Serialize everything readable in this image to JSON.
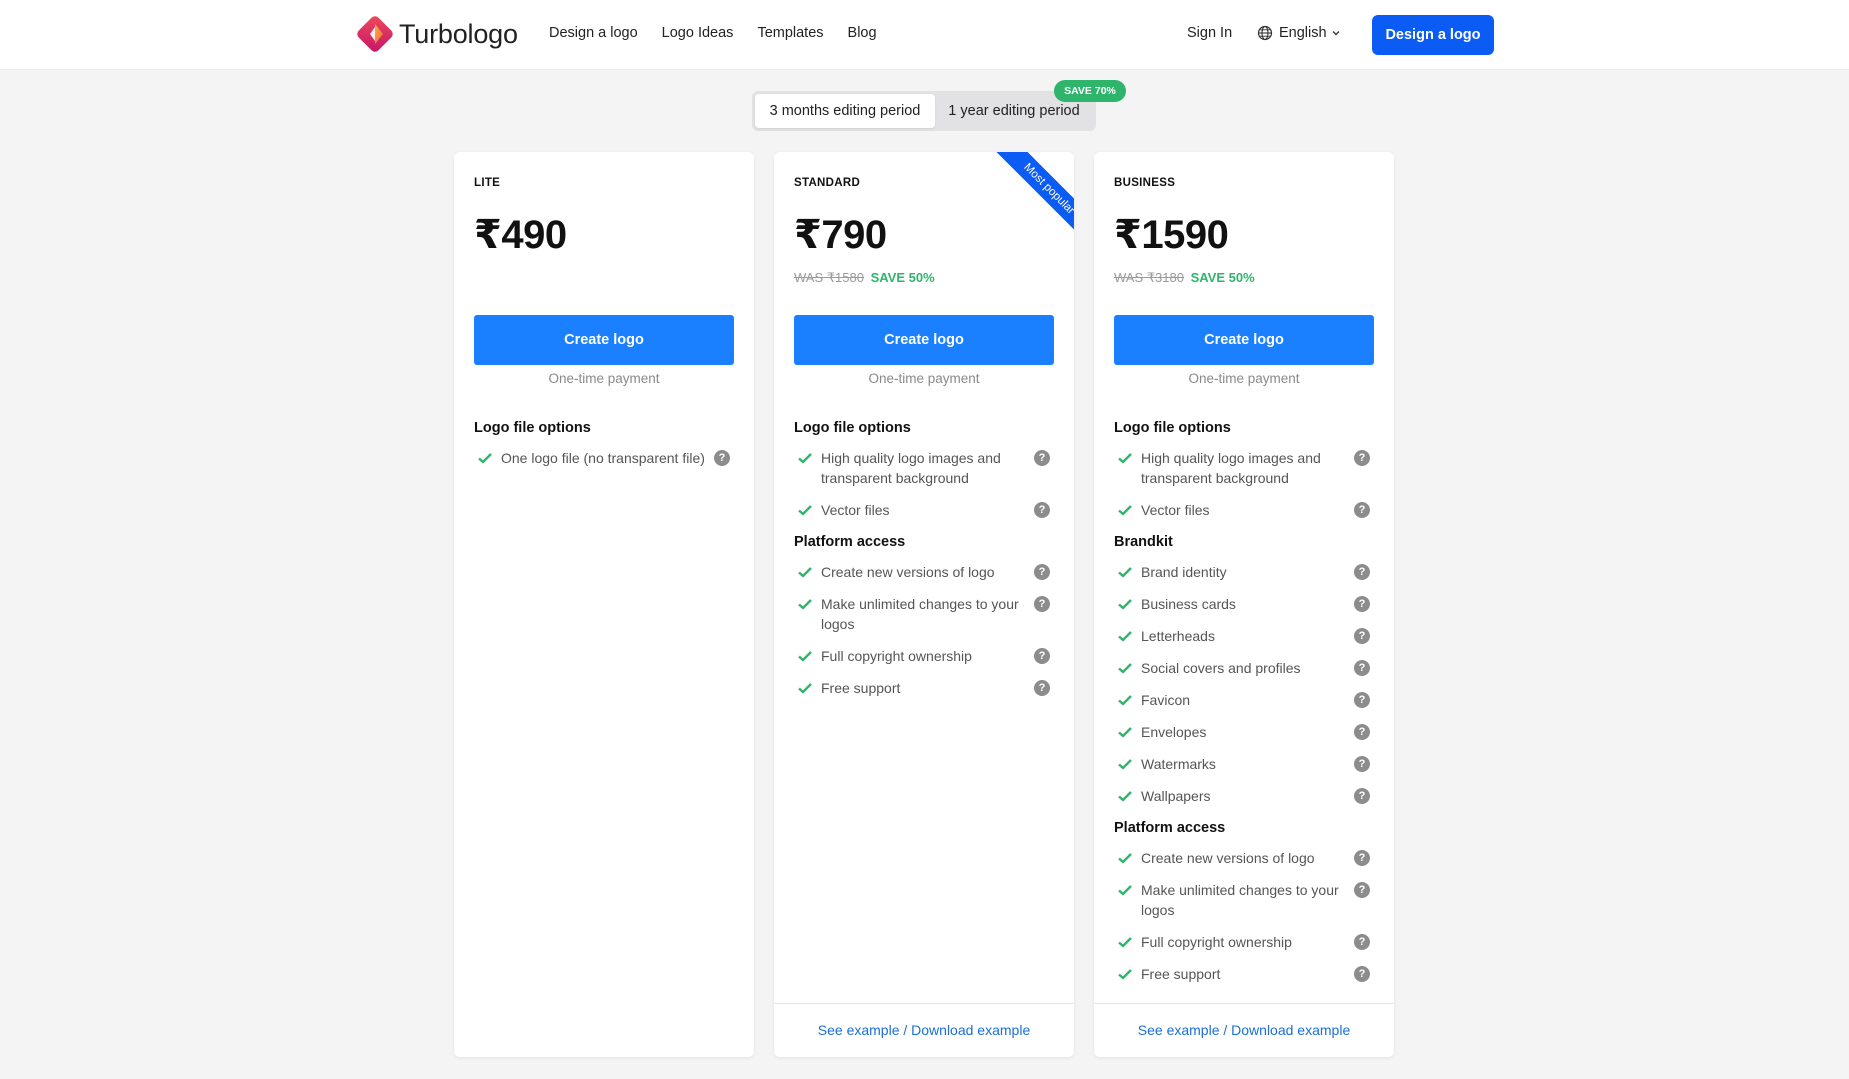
{
  "header": {
    "brand": "Turbologo",
    "nav": [
      {
        "label": "Design a logo"
      },
      {
        "label": "Logo Ideas"
      },
      {
        "label": "Templates"
      },
      {
        "label": "Blog"
      }
    ],
    "sign_in": "Sign In",
    "language": "English",
    "cta": "Design a logo"
  },
  "period_toggle": {
    "options": [
      {
        "label": "3 months editing period",
        "selected": true
      },
      {
        "label": "1 year editing period",
        "selected": false
      }
    ],
    "badge": "SAVE 70%"
  },
  "plans": [
    {
      "name": "LITE",
      "price": "₹490",
      "button": "Create logo",
      "payment_note": "One-time payment",
      "sections": [
        {
          "title": "Logo file options",
          "features": [
            "One logo file (no transparent file)"
          ]
        }
      ]
    },
    {
      "name": "STANDARD",
      "price": "₹790",
      "was": "WAS ₹1580",
      "save": "SAVE 50%",
      "ribbon": "Most popular",
      "button": "Create logo",
      "payment_note": "One-time payment",
      "sections": [
        {
          "title": "Logo file options",
          "features": [
            "High quality logo images and transparent background",
            "Vector files"
          ]
        },
        {
          "title": "Platform access",
          "features": [
            "Create new versions of logo",
            "Make unlimited changes to your logos",
            "Full copyright ownership",
            "Free support"
          ]
        }
      ],
      "footer": {
        "see": "See example",
        "separator": "/",
        "download": "Download example"
      }
    },
    {
      "name": "BUSINESS",
      "price": "₹1590",
      "was": "WAS ₹3180",
      "save": "SAVE 50%",
      "button": "Create logo",
      "payment_note": "One-time payment",
      "sections": [
        {
          "title": "Logo file options",
          "features": [
            "High quality logo images and transparent background",
            "Vector files"
          ]
        },
        {
          "title": "Brandkit",
          "features": [
            "Brand identity",
            "Business cards",
            "Letterheads",
            "Social covers and profiles",
            "Favicon",
            "Envelopes",
            "Watermarks",
            "Wallpapers"
          ]
        },
        {
          "title": "Platform access",
          "features": [
            "Create new versions of logo",
            "Make unlimited changes to your logos",
            "Full copyright ownership",
            "Free support"
          ]
        }
      ],
      "footer": {
        "see": "See example",
        "separator": "/",
        "download": "Download example"
      }
    }
  ],
  "colors": {
    "primary": "#0a5cf5",
    "button": "#1a80ff",
    "success": "#2fb46b",
    "link": "#1a6fd8"
  },
  "icons": {
    "check": "check-icon",
    "help": "question-circle-icon",
    "globe": "globe-icon",
    "chevron": "chevron-down-icon"
  }
}
